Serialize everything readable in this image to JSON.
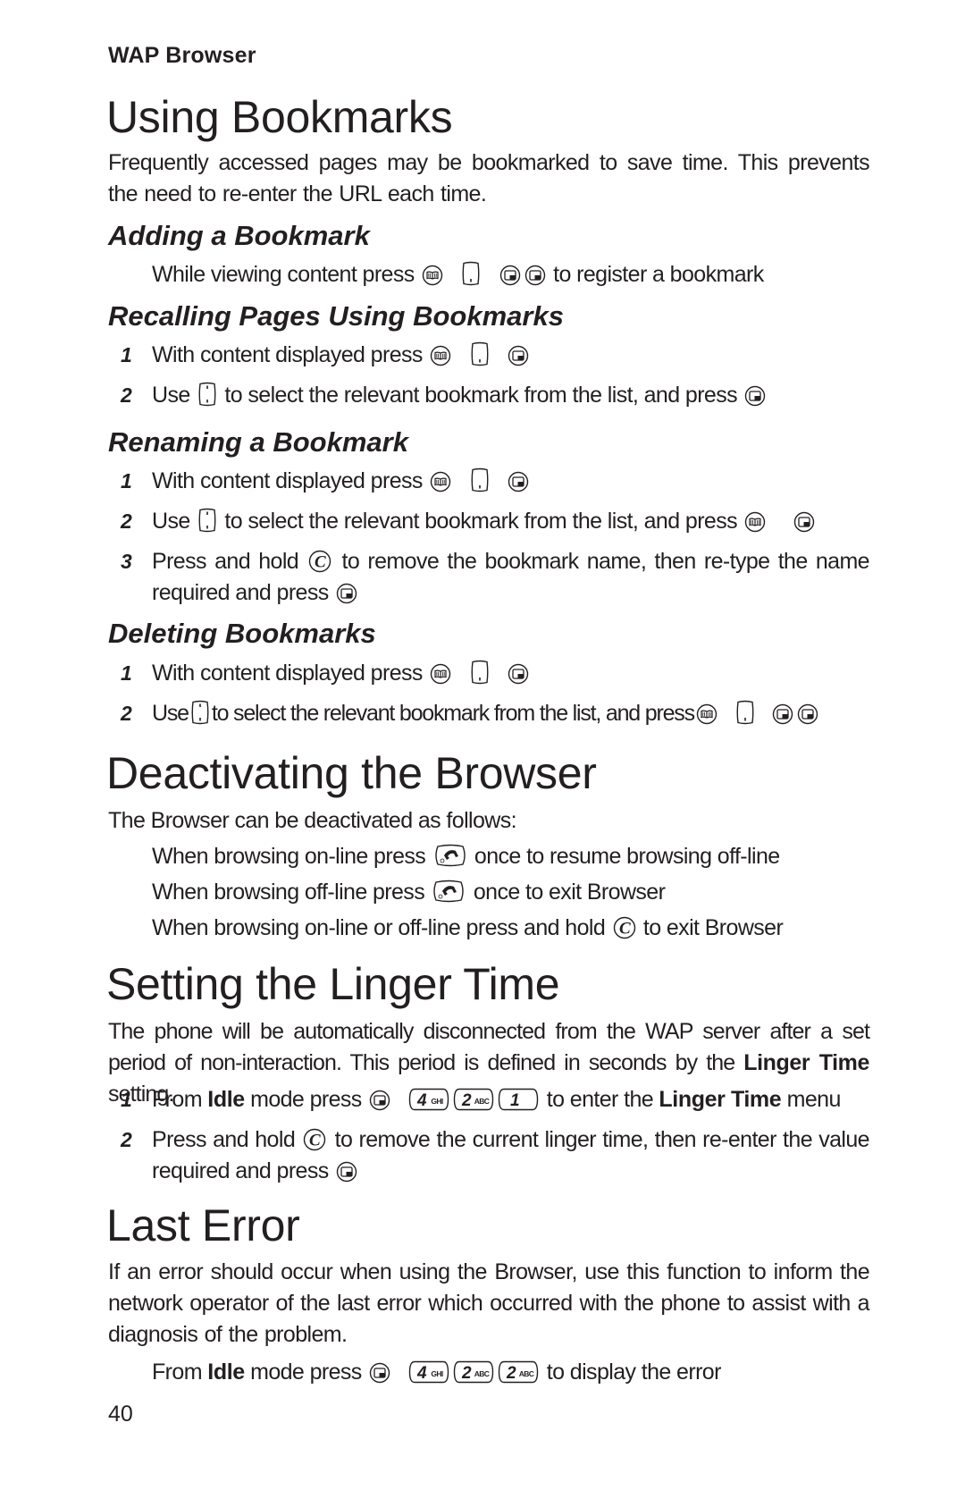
{
  "running_head": "WAP Browser",
  "page_number": "40",
  "sections": {
    "using_bookmarks": {
      "title": "Using Bookmarks",
      "intro": "Frequently accessed pages may be bookmarked to save time. This prevents the need to re-enter the URL each time."
    },
    "adding": {
      "title": "Adding a Bookmark",
      "line_before": "While viewing content press",
      "keys": [
        "book-key",
        "nav-down-key",
        "select-key",
        "select-key"
      ],
      "line_after": "to register a bookmark"
    },
    "recalling": {
      "title": "Recalling Pages Using Bookmarks",
      "steps": [
        {
          "n": "1",
          "before": "With content displayed press",
          "keys": [
            "book-key",
            "nav-down-key",
            "select-key"
          ],
          "after": ""
        },
        {
          "n": "2",
          "pre": "Use",
          "pre_key": "nav-updown-key",
          "before": "to select the relevant bookmark from the list, and press",
          "keys": [
            "select-key"
          ],
          "after": ""
        }
      ]
    },
    "renaming": {
      "title": "Renaming a Bookmark",
      "steps": [
        {
          "n": "1",
          "before": "With content displayed press",
          "keys": [
            "book-key",
            "nav-down-key",
            "select-key"
          ]
        },
        {
          "n": "2",
          "pre": "Use",
          "pre_key": "nav-updown-key",
          "before": "to select the relevant bookmark from the list, and press",
          "keys": [
            "book-key",
            "select-key"
          ]
        },
        {
          "n": "3",
          "pre": "Press and hold",
          "pre_key": "clear-key",
          "before": "to remove the bookmark name, then re-type the name required and press",
          "keys": [
            "select-key"
          ]
        }
      ]
    },
    "deleting": {
      "title": "Deleting Bookmarks",
      "steps": [
        {
          "n": "1",
          "before": "With content displayed press",
          "keys": [
            "book-key",
            "nav-down-key",
            "select-key"
          ]
        },
        {
          "n": "2",
          "pre": "Use",
          "pre_key": "nav-updown-key",
          "before": "to select the relevant bookmark from the list, and press",
          "keys": [
            "book-key",
            "nav-down-key",
            "select-key",
            "select-key"
          ]
        }
      ]
    },
    "deactivating": {
      "title": "Deactivating the Browser",
      "intro": "The Browser can be deactivated as follows:",
      "items": [
        {
          "before": "When browsing on-line press",
          "key": "end-key",
          "after": "once to resume browsing off-line"
        },
        {
          "before": "When browsing off-line press",
          "key": "end-key",
          "after": "once to exit Browser"
        },
        {
          "before": "When browsing on-line or off-line press and hold",
          "key": "clear-key",
          "after": "to exit Browser"
        }
      ]
    },
    "linger": {
      "title": "Setting the Linger Time",
      "intro_1": "The phone will be automatically disconnected from the WAP server after a set period of non-interaction. This period is defined in seconds by the ",
      "intro_bold": "Linger Time",
      "intro_2": " setting.",
      "step1": {
        "n": "1",
        "a": "From ",
        "a_bold": "Idle",
        "b": " mode press",
        "digits": [
          {
            "d": "4",
            "l": "GHI"
          },
          {
            "d": "2",
            "l": "ABC"
          },
          {
            "d": "1",
            "l": ""
          }
        ],
        "c": "to enter the ",
        "c_bold": "Linger Time",
        "d": " menu"
      },
      "step2": {
        "n": "2",
        "pre": "Press and hold",
        "after": "to remove the current linger time, then re-enter the value required and press"
      }
    },
    "last_error": {
      "title": "Last Error",
      "intro": "If an error should occur when using the Browser, use this function to inform the network operator of the last error which occurred with the phone to assist with a diagnosis of the problem.",
      "line": {
        "a": "From ",
        "a_bold": "Idle",
        "b": " mode press",
        "digits": [
          {
            "d": "4",
            "l": "GHI"
          },
          {
            "d": "2",
            "l": "ABC"
          },
          {
            "d": "2",
            "l": "ABC"
          }
        ],
        "c": "to display the error"
      }
    }
  }
}
